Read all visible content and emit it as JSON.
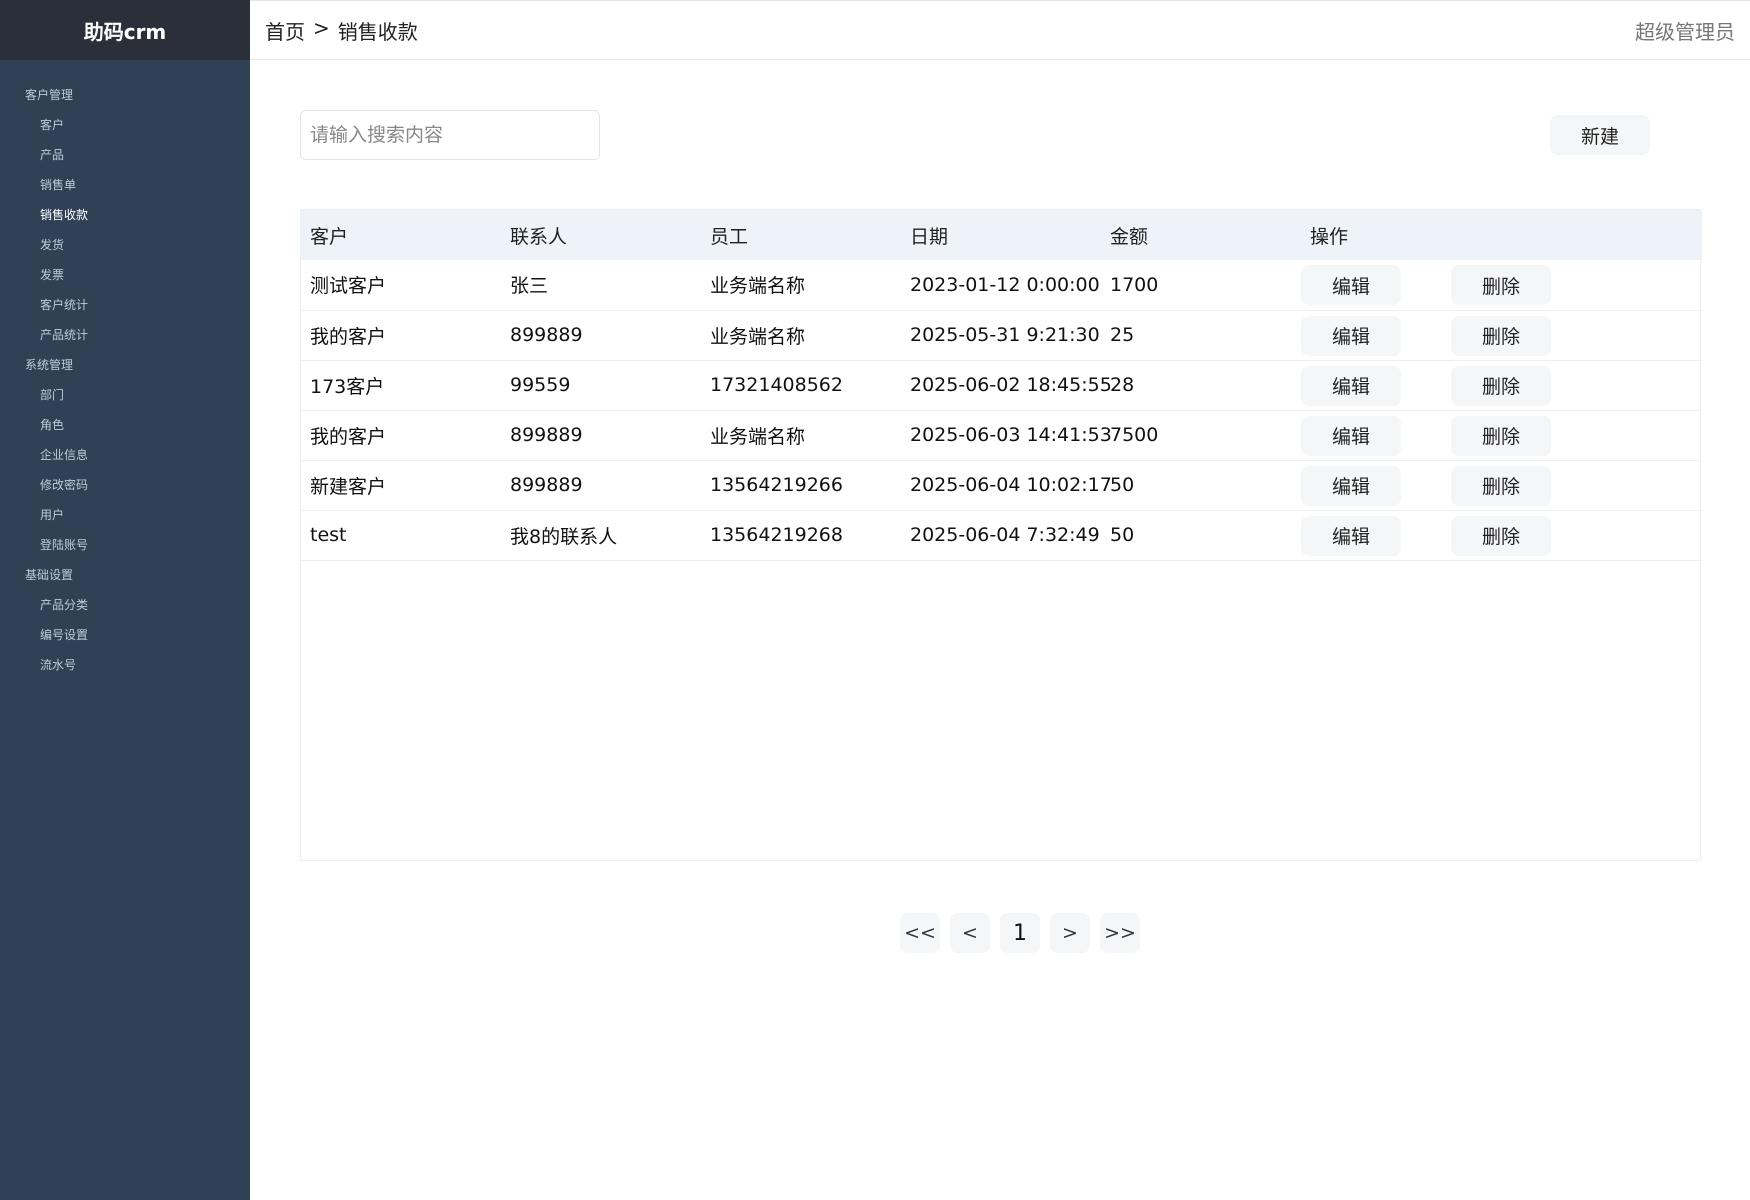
{
  "brand": "助码crm",
  "breadcrumb": {
    "home": "首页",
    "sep": ">",
    "current": "销售收款"
  },
  "user": "超级管理员",
  "sidebar": [
    {
      "type": "group",
      "label": "客户管理"
    },
    {
      "type": "item",
      "label": "客户"
    },
    {
      "type": "item",
      "label": "产品"
    },
    {
      "type": "item",
      "label": "销售单"
    },
    {
      "type": "item",
      "label": "销售收款",
      "active": true
    },
    {
      "type": "item",
      "label": "发货"
    },
    {
      "type": "item",
      "label": "发票"
    },
    {
      "type": "item",
      "label": "客户统计"
    },
    {
      "type": "item",
      "label": "产品统计"
    },
    {
      "type": "group",
      "label": "系统管理"
    },
    {
      "type": "item",
      "label": "部门"
    },
    {
      "type": "item",
      "label": "角色"
    },
    {
      "type": "item",
      "label": "企业信息"
    },
    {
      "type": "item",
      "label": "修改密码"
    },
    {
      "type": "item",
      "label": "用户"
    },
    {
      "type": "item",
      "label": "登陆账号"
    },
    {
      "type": "group",
      "label": "基础设置"
    },
    {
      "type": "item",
      "label": "产品分类"
    },
    {
      "type": "item",
      "label": "编号设置"
    },
    {
      "type": "item",
      "label": "流水号"
    }
  ],
  "search": {
    "placeholder": "请输入搜索内容",
    "value": ""
  },
  "toolbar": {
    "new_label": "新建"
  },
  "table": {
    "columns": [
      "客户",
      "联系人",
      "员工",
      "日期",
      "金额",
      "操作"
    ],
    "edit_label": "编辑",
    "delete_label": "删除",
    "rows": [
      {
        "customer": "测试客户",
        "contact": "张三",
        "employee": "业务端名称",
        "date": "2023-01-12 0:00:00",
        "amount": "1700"
      },
      {
        "customer": "我的客户",
        "contact": "899889",
        "employee": "业务端名称",
        "date": "2025-05-31 9:21:30",
        "amount": "25"
      },
      {
        "customer": "173客户",
        "contact": "99559",
        "employee": "17321408562",
        "date": "2025-06-02 18:45:55",
        "amount": "28"
      },
      {
        "customer": "我的客户",
        "contact": "899889",
        "employee": "业务端名称",
        "date": "2025-06-03 14:41:53",
        "amount": "7500"
      },
      {
        "customer": "新建客户",
        "contact": "899889",
        "employee": "13564219266",
        "date": "2025-06-04 10:02:17",
        "amount": "50"
      },
      {
        "customer": "test",
        "contact": "我8的联系人",
        "employee": "13564219268",
        "date": "2025-06-04 7:32:49",
        "amount": "50"
      }
    ]
  },
  "pagination": {
    "first": "<<",
    "prev": "<",
    "current": "1",
    "next": ">",
    "last": ">>"
  }
}
